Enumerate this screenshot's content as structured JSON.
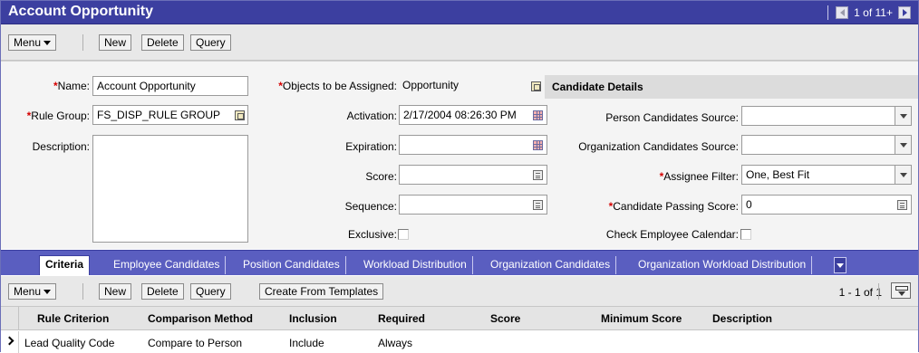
{
  "window": {
    "title": "Account Opportunity",
    "pager_text": "1 of 11+"
  },
  "top_toolbar": {
    "menu_label": "Menu",
    "new_label": "New",
    "delete_label": "Delete",
    "query_label": "Query"
  },
  "form": {
    "name_label": "Name:",
    "name_value": "Account Opportunity",
    "rule_group_label": "Rule Group:",
    "rule_group_value": "FS_DISP_RULE GROUP",
    "description_label": "Description:",
    "description_value": "",
    "objects_label": "Objects to be Assigned:",
    "objects_value": "Opportunity",
    "activation_label": "Activation:",
    "activation_value": "2/17/2004 08:26:30 PM",
    "expiration_label": "Expiration:",
    "expiration_value": "",
    "score_label": "Score:",
    "score_value": "",
    "sequence_label": "Sequence:",
    "sequence_value": "",
    "exclusive_label": "Exclusive:",
    "candidate_details_header": "Candidate Details",
    "person_source_label": "Person Candidates Source:",
    "person_source_value": "",
    "org_source_label": "Organization Candidates Source:",
    "org_source_value": "",
    "assignee_filter_label": "Assignee Filter:",
    "assignee_filter_value": "One, Best Fit",
    "passing_score_label": "Candidate Passing Score:",
    "passing_score_value": "0",
    "check_calendar_label": "Check Employee Calendar:"
  },
  "tabs": [
    {
      "label": "Criteria",
      "active": true
    },
    {
      "label": "Employee Candidates",
      "active": false
    },
    {
      "label": "Position Candidates",
      "active": false
    },
    {
      "label": "Workload Distribution",
      "active": false
    },
    {
      "label": "Organization Candidates",
      "active": false
    },
    {
      "label": "Organization Workload Distribution",
      "active": false
    }
  ],
  "list_toolbar": {
    "menu_label": "Menu",
    "new_label": "New",
    "delete_label": "Delete",
    "query_label": "Query",
    "templates_label": "Create From Templates",
    "count_text": "1 - 1 of 1"
  },
  "table": {
    "columns": [
      "Rule Criterion",
      "Comparison Method",
      "Inclusion",
      "Required",
      "Score",
      "Minimum Score",
      "Description"
    ],
    "rows": [
      [
        "Lead Quality Code",
        "Compare to Person",
        "Include",
        "Always",
        "",
        "",
        ""
      ]
    ]
  },
  "colors": {
    "title_bar": "#3c3fa0",
    "tab_strip": "#5a5ec0",
    "required_mark": "#d40000"
  }
}
